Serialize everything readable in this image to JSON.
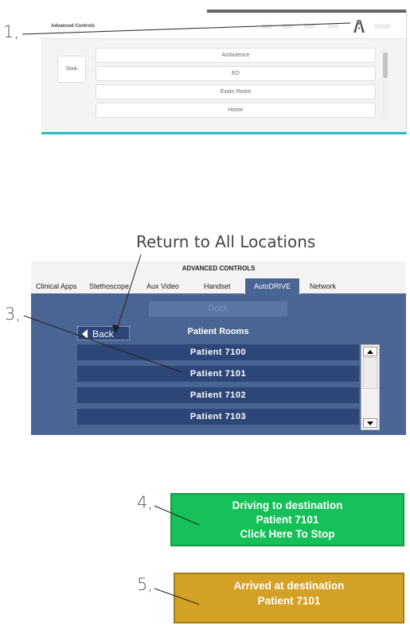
{
  "steps": {
    "one": "1,",
    "three": "3,",
    "four": "4,",
    "five": "5,"
  },
  "panel1": {
    "title": "Advanced Controls",
    "dock_label": "Dock",
    "items": [
      "Ambulence",
      "ED",
      "Exam Room",
      "Home"
    ],
    "icon": "road-navigation-icon"
  },
  "callout_return": "Return to All Locations",
  "panel3": {
    "title": "ADVANCED CONTROLS",
    "tabs": [
      "Clinical Apps",
      "Stethoscope",
      "Aux Video",
      "Handset",
      "AutoDRIVE",
      "Network"
    ],
    "active_tab": "AutoDRIVE",
    "dock_label": "Dock",
    "back_label": "Back",
    "section_title": "Patient Rooms",
    "rooms": [
      "Patient 7100",
      "Patient 7101",
      "Patient 7102",
      "Patient 7103"
    ]
  },
  "banner_driving": {
    "line1": "Driving to destination",
    "line2": "Patient 7101",
    "line3": "Click Here To Stop"
  },
  "banner_arrived": {
    "line1": "Arrived at destination",
    "line2": "Patient 7101"
  },
  "colors": {
    "panel_blue": "#4a6494",
    "item_blue": "#2d4577",
    "driving_green": "#16c058",
    "arrived_gold": "#d4a127",
    "accent_teal": "#2ab8c0"
  }
}
